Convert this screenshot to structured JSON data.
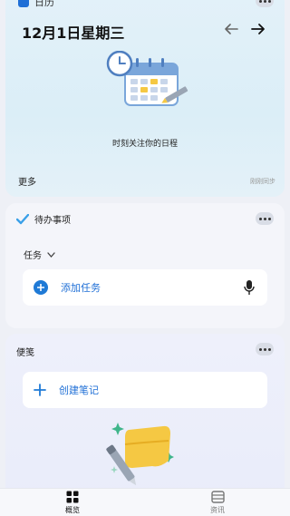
{
  "calendar": {
    "app_name": "日历",
    "date": "12月1日星期三",
    "caption": "时刻关注你的日程",
    "more": "更多",
    "sync_status": "刚刚同步"
  },
  "todo": {
    "title": "待办事项",
    "filter": "任务",
    "add_task": "添加任务"
  },
  "notes": {
    "title": "便笺",
    "create_note": "创建笔记"
  },
  "nav": {
    "items": [
      {
        "label": "概览",
        "icon": "grid-icon",
        "active": true
      },
      {
        "label": "资讯",
        "icon": "news-icon",
        "active": false
      }
    ]
  },
  "colors": {
    "accent": "#1f7ad6",
    "calendar_bg": "#dbeef7",
    "notes_bg": "#eef0fb",
    "card_bg": "#f4f5fa"
  }
}
